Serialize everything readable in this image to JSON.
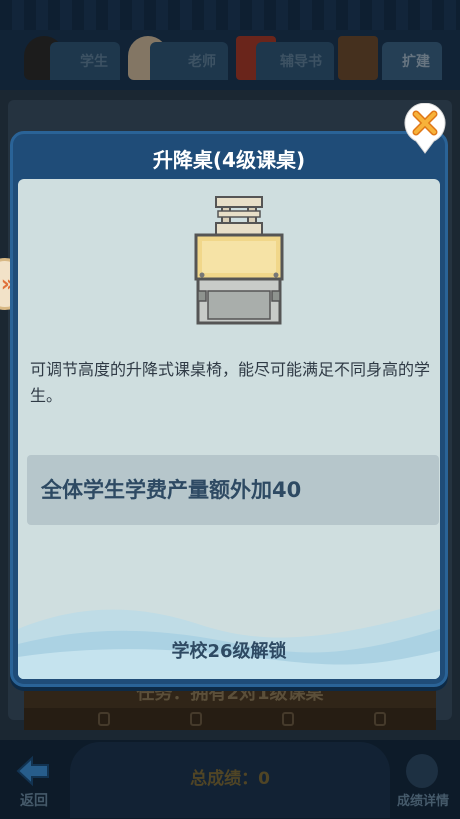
{
  "tabs": [
    {
      "label": "学生"
    },
    {
      "label": "老师"
    },
    {
      "label": "辅导书"
    },
    {
      "label": "扩建"
    }
  ],
  "background": {
    "task_text": "任务：拥有2对1级课桌",
    "total_score": "总成绩：0",
    "back_label": "返回",
    "detail_label": "成绩详情"
  },
  "dialog": {
    "title": "升降桌(4级课桌)",
    "description": "可调节高度的升降式课桌椅，能尽可能满足不同身高的学生。",
    "bonus": "全体学生学费产量额外加40",
    "unlock": "学校26级解锁"
  },
  "icons": {
    "close": "close-x-icon",
    "side": "double-chevron-right-icon",
    "back": "back-arrow-icon",
    "detail": "report-icon"
  },
  "colors": {
    "dialog_frame": "#1f4c78",
    "dialog_body": "#cfdedf",
    "bonus_bg": "#b6c6cb",
    "close_orange": "#f39a1f"
  }
}
